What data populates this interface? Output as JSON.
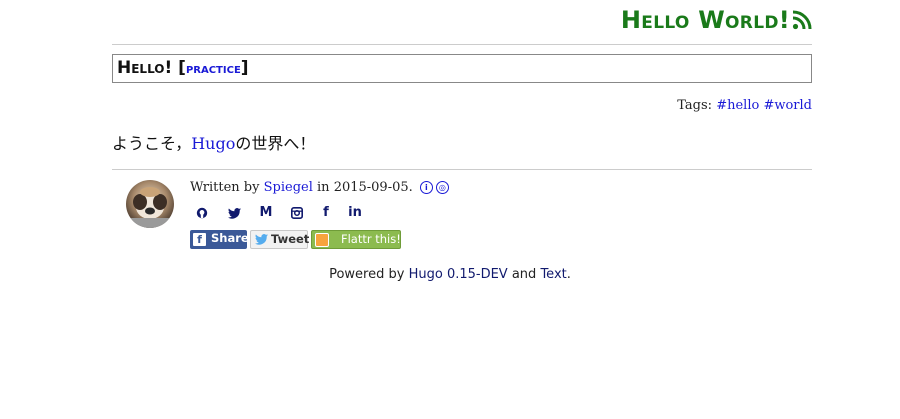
{
  "site": {
    "title": "Hello World!",
    "rss_icon": "rss-icon"
  },
  "post": {
    "title": "Hello!",
    "bracket_open": "[",
    "category": "practice",
    "bracket_close": "]",
    "tags_label": "Tags:",
    "tags": [
      "#hello",
      "#world"
    ],
    "content_pre": "ようこそ，",
    "content_link": "Hugo",
    "content_post": "の世界へ！"
  },
  "author": {
    "written_by": "Written by",
    "name": "Spiegel",
    "in_text": "in",
    "date": "2015-09-05.",
    "license_icons": [
      "cc-by-icon",
      "cc-sa-icon"
    ],
    "social_icons": [
      "github-icon",
      "twitter-icon",
      "medium-icon",
      "instagram-icon",
      "facebook-icon",
      "linkedin-icon"
    ]
  },
  "share": {
    "facebook": "Share",
    "twitter": "Tweet",
    "flattr": "Flattr this!"
  },
  "footer": {
    "powered_by": "Powered by",
    "hugo": "Hugo 0.15-DEV",
    "and": "and",
    "text": "Text",
    "period": "."
  },
  "colors": {
    "site_title": "#1a7a1a",
    "link": "#1a1ad6",
    "facebook": "#3b5998",
    "flattr": "#8cbb4f"
  }
}
